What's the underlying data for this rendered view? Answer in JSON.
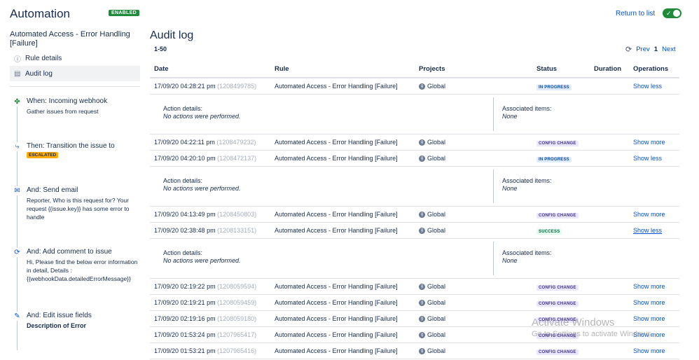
{
  "header": {
    "app_title": "Automation",
    "enabled_badge": "ENABLED",
    "return_link": "Return to list"
  },
  "sidebar": {
    "rule_name": "Automated Access - Error Handling [Failure]",
    "nav": [
      {
        "label": "Rule details",
        "icon": "info-icon"
      },
      {
        "label": "Audit log",
        "icon": "document-icon",
        "active": true
      }
    ],
    "steps": [
      {
        "icon": "webhook-icon",
        "head": "When: Incoming webhook",
        "sub": "Gather issues from request"
      },
      {
        "icon": "transition-icon",
        "head": "Then: Transition the issue to",
        "badge": "ESCALATED"
      },
      {
        "icon": "email-icon",
        "head": "And: Send email",
        "sub": "Reporter, Who is this request for? Your request {{issue.key}} has some error to handle"
      },
      {
        "icon": "comment-icon",
        "head": "And: Add comment to issue",
        "sub": "Hi, Please find the below error information in detail, Details : {{webhookData.detailedErrorMessage}}"
      },
      {
        "icon": "pencil-icon",
        "head": "And: Edit issue fields",
        "sub": "Description of Error"
      }
    ]
  },
  "main": {
    "title": "Audit log",
    "range": "1-50",
    "pager": {
      "prev": "Prev",
      "current": "1",
      "next": "Next"
    },
    "columns": [
      "Date",
      "Rule",
      "Projects",
      "Status",
      "Duration",
      "Operations"
    ],
    "details": {
      "action_label": "Action details:",
      "action_value": "No actions were performed.",
      "assoc_label": "Associated items:",
      "assoc_value": "None"
    },
    "rows": [
      {
        "date": "17/09/20 04:28:21 pm",
        "id": "(1208499785)",
        "rule": "Automated Access - Error Handling [Failure]",
        "project": "Global",
        "status": "IN PROGRESS",
        "op": "Show less"
      },
      {
        "date": "17/09/20 04:22:11 pm",
        "id": "(1208479232)",
        "rule": "Automated Access - Error Handling [Failure]",
        "project": "Global",
        "status": "CONFIG CHANGE",
        "op": "Show more"
      },
      {
        "date": "17/09/20 04:20:10 pm",
        "id": "(1208472137)",
        "rule": "Automated Access - Error Handling [Failure]",
        "project": "Global",
        "status": "IN PROGRESS",
        "op": "Show less"
      },
      {
        "date": "17/09/20 04:13:49 pm",
        "id": "(1208450803)",
        "rule": "Automated Access - Error Handling [Failure]",
        "project": "Global",
        "status": "CONFIG CHANGE",
        "op": "Show more"
      },
      {
        "date": "17/09/20 02:38:48 pm",
        "id": "(1208133151)",
        "rule": "Automated Access - Error Handling [Failure]",
        "project": "Global",
        "status": "SUCCESS",
        "op": "Show less"
      },
      {
        "date": "17/09/20 02:19:22 pm",
        "id": "(1208059594)",
        "rule": "Automated Access - Error Handling [Failure]",
        "project": "Global",
        "status": "CONFIG CHANGE",
        "op": "Show more"
      },
      {
        "date": "17/09/20 02:19:21 pm",
        "id": "(1208059459)",
        "rule": "Automated Access - Error Handling [Failure]",
        "project": "Global",
        "status": "CONFIG CHANGE",
        "op": "Show more"
      },
      {
        "date": "17/09/20 02:19:16 pm",
        "id": "(1208059180)",
        "rule": "Automated Access - Error Handling [Failure]",
        "project": "Global",
        "status": "CONFIG CHANGE",
        "op": "Show more"
      },
      {
        "date": "17/09/20 01:53:24 pm",
        "id": "(1207965417)",
        "rule": "Automated Access - Error Handling [Failure]",
        "project": "Global",
        "status": "CONFIG CHANGE",
        "op": "Show more"
      },
      {
        "date": "17/09/20 01:53:21 pm",
        "id": "(1207965416)",
        "rule": "Automated Access - Error Handling [Failure]",
        "project": "Global",
        "status": "CONFIG CHANGE",
        "op": "Show more"
      }
    ]
  },
  "watermark": {
    "line1": "Activate Windows",
    "line2": "Go to Settings to activate Windows."
  },
  "colors": {
    "accent": "#0052cc",
    "enabled": "#1f8a3a",
    "escalated": "#ffab00"
  }
}
